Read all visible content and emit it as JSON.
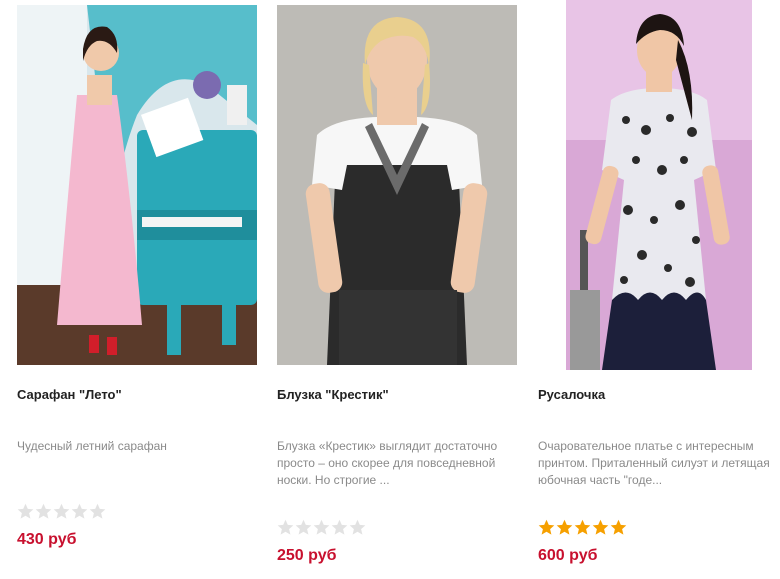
{
  "products": [
    {
      "name": "Сарафан \"Лето\"",
      "description": "Чудесный летний сарафан",
      "rating": 0,
      "price": "430 руб",
      "image": "woman-in-pink-dress-at-turquoise-piano"
    },
    {
      "name": "Блузка \"Крестик\"",
      "description": "Блузка «Крестик» выглядит достаточно просто – оно скорее для повседневной носки. Но строгие ...",
      "rating": 0,
      "price": "250 руб",
      "image": "woman-in-black-white-blouse"
    },
    {
      "name": "Русалочка",
      "description": "Очаровательное платье с интересным принтом. Приталенный силуэт и летящая юбочная часть \"годе...",
      "rating": 5,
      "price": "600 руб",
      "image": "woman-in-leopard-print-dress"
    }
  ],
  "colors": {
    "price": "#c8102e",
    "star_filled": "#f6a000",
    "star_empty": "#e2e2e2"
  }
}
